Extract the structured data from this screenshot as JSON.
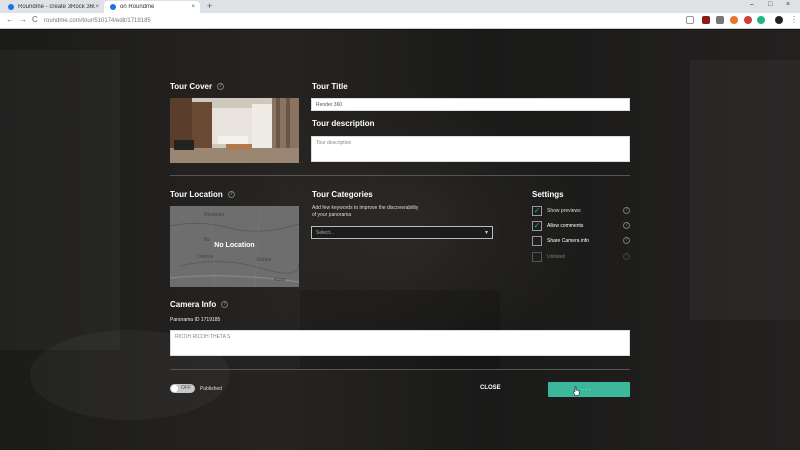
{
  "browser": {
    "tabs": [
      {
        "label": "Roundme - create 3Rock 360 VR",
        "close": "×"
      },
      {
        "label": "on Roundme",
        "close": "×"
      }
    ],
    "new_tab": "+",
    "window_controls": [
      "–",
      "□",
      "×"
    ],
    "nav": {
      "back": "←",
      "forward": "→",
      "reload": "C"
    },
    "url": "roundme.com/tour/510174/edit/1719185"
  },
  "form": {
    "tour_cover": {
      "title": "Tour Cover",
      "help": "?"
    },
    "tour_title": {
      "title": "Tour Title",
      "value": "Render 360"
    },
    "tour_description": {
      "title": "Tour description",
      "placeholder": "Tour description"
    },
    "tour_location": {
      "title": "Tour Location",
      "help": "?",
      "map_label": "No Location",
      "map_places": [
        "Romania",
        "Bu",
        "Craiova",
        "Slatina",
        "Ruse"
      ]
    },
    "tour_categories": {
      "title": "Tour Categories",
      "hint_line1": "Add few keywords to improve the discoverability",
      "hint_line2": "of your panorama",
      "select_value": "Select...",
      "chevron": "▾"
    },
    "settings": {
      "title": "Settings",
      "items": [
        {
          "label": "Show previews",
          "checked": true,
          "mark": "✓",
          "help": "?"
        },
        {
          "label": "Allow comments",
          "checked": true,
          "mark": "✓",
          "help": "?"
        },
        {
          "label": "Share Camera info",
          "checked": false,
          "mark": "",
          "help": "?"
        },
        {
          "label": "Unlisted",
          "checked": false,
          "mark": "",
          "help": "?"
        }
      ]
    },
    "camera_info": {
      "title": "Camera Info",
      "help": "?",
      "panorama_id": "Panorama ID 1719185",
      "value": "RICOH RICOH THETA S"
    },
    "publish_toggle": {
      "state_label": "OFF",
      "status_text": "Published"
    },
    "close_label": "CLOSE",
    "save_label": ". . ."
  },
  "colors": {
    "accent": "#3db79b",
    "check": "#2aa98c",
    "background": "#141414"
  }
}
